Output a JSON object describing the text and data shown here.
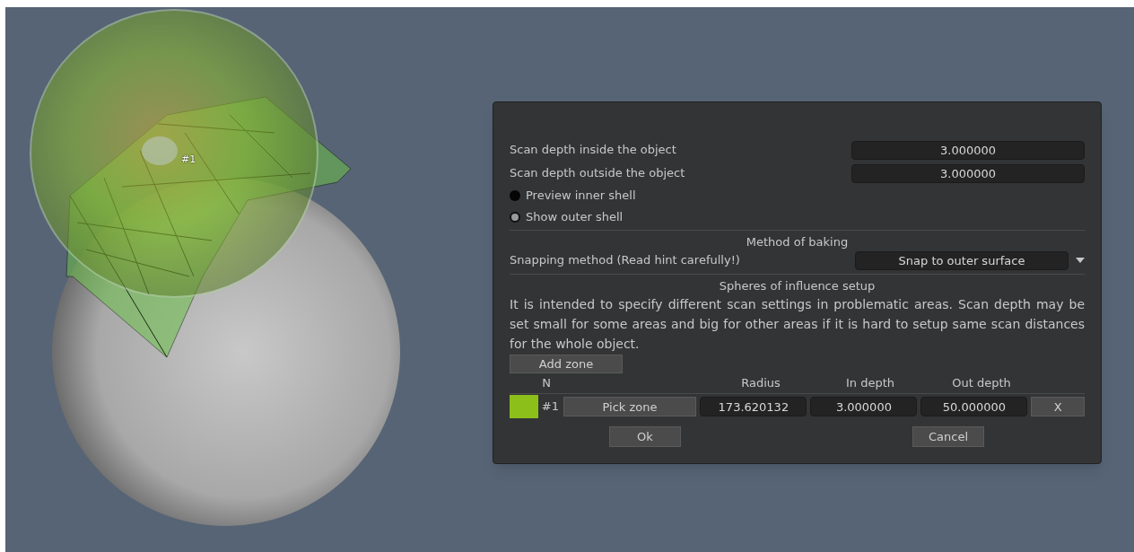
{
  "viewport": {
    "label": "#1"
  },
  "dialog": {
    "fields": [
      {
        "label": "Scan depth inside the object",
        "value": "3.000000"
      },
      {
        "label": "Scan depth outside the object",
        "value": "3.000000"
      }
    ],
    "toggles": [
      {
        "label": "Preview inner shell",
        "checked": false
      },
      {
        "label": "Show outer shell",
        "checked": true
      }
    ],
    "baking": {
      "heading": "Method of baking",
      "label": "Snapping method (Read hint carefully!)",
      "value": "Snap to outer surface"
    },
    "spheres": {
      "heading": "Spheres of influence setup",
      "description": "It is intended to specify different scan settings in problematic areas. Scan depth may be set small for some areas and big for other areas if it is hard to setup same scan distances for the whole object.",
      "add_button": "Add zone",
      "columns": [
        "N",
        "Radius",
        "In depth",
        "Out depth"
      ],
      "zones": [
        {
          "color": "#8dbf1b",
          "number": "#1",
          "pick_button": "Pick zone",
          "radius": "173.620132",
          "in_depth": "3.000000",
          "out_depth": "50.000000",
          "remove_button": "X"
        }
      ]
    },
    "buttons": [
      "Ok",
      "Cancel"
    ]
  }
}
